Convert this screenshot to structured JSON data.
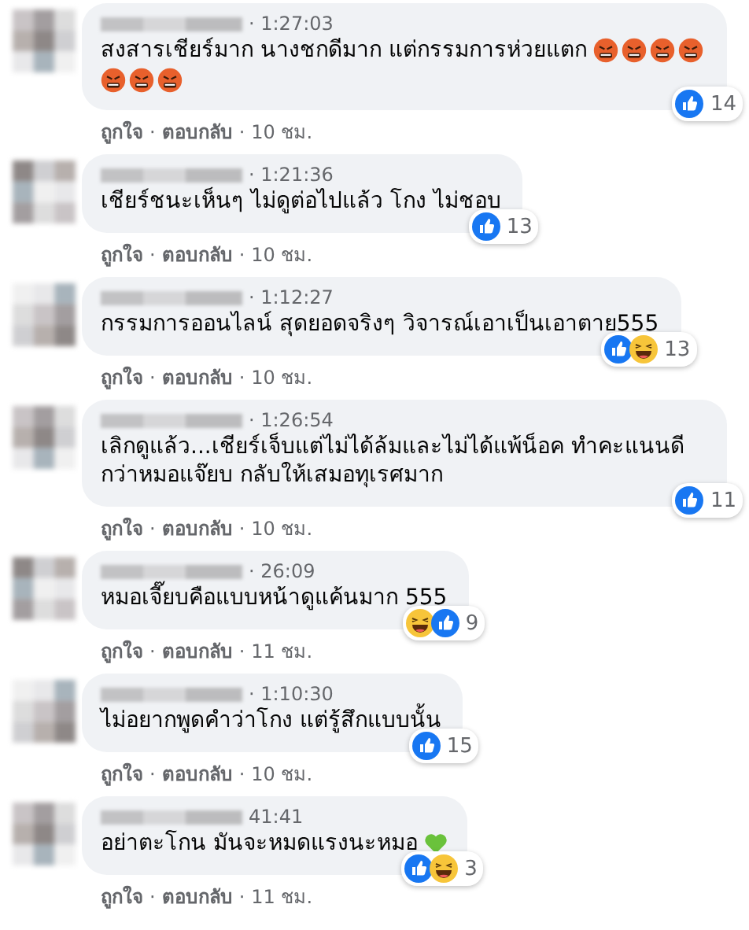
{
  "comments": [
    {
      "time": "· 1:27:03",
      "text": "สงสารเชียร์มาก นางชกดีมาก แต่กรรมการห่วยแตก",
      "emojis": [
        {
          "kind": "angry"
        },
        {
          "kind": "angry"
        },
        {
          "kind": "angry"
        },
        {
          "kind": "angry"
        },
        {
          "kind": "angry"
        },
        {
          "kind": "angry"
        },
        {
          "kind": "angry"
        }
      ],
      "reactions": [
        {
          "kind": "like"
        }
      ],
      "reaction_count": "14",
      "actions": [
        {
          "kind": "link",
          "text": "ถูกใจ"
        },
        {
          "kind": "sep",
          "text": "·"
        },
        {
          "kind": "link",
          "text": "ตอบกลับ"
        },
        {
          "kind": "sep",
          "text": "·"
        },
        {
          "kind": "age",
          "text": "10 ชม."
        }
      ]
    },
    {
      "time": "· 1:21:36",
      "text": "เชียร์ชนะเห็นๆ ไม่ดูต่อไปแล้ว โกง ไม่ชอบ",
      "reactions": [
        {
          "kind": "like"
        }
      ],
      "reaction_count": "13",
      "actions": [
        {
          "kind": "link",
          "text": "ถูกใจ"
        },
        {
          "kind": "sep",
          "text": "·"
        },
        {
          "kind": "link",
          "text": "ตอบกลับ"
        },
        {
          "kind": "sep",
          "text": "·"
        },
        {
          "kind": "age",
          "text": "10 ชม."
        }
      ]
    },
    {
      "time": "· 1:12:27",
      "text": "กรรมการออนไลน์ สุดยอดจริงๆ วิจารณ์เอาเป็นเอาตาย555",
      "reactions": [
        {
          "kind": "like"
        },
        {
          "kind": "haha"
        }
      ],
      "reaction_count": "13",
      "actions": [
        {
          "kind": "link",
          "text": "ถูกใจ"
        },
        {
          "kind": "sep",
          "text": "·"
        },
        {
          "kind": "link",
          "text": "ตอบกลับ"
        },
        {
          "kind": "sep",
          "text": "·"
        },
        {
          "kind": "age",
          "text": "10 ชม."
        }
      ]
    },
    {
      "time": "· 1:26:54",
      "text": "เลิกดูแล้ว...เชียร์เจ็บแต่ไม่ได้ล้มและไม่ได้แพ้น็อค ทำคะแนนดีกว่าหมอแจ๊ยบ กลับให้เสมอทุเรศมาก",
      "reactions": [
        {
          "kind": "like"
        }
      ],
      "reaction_count": "11",
      "actions": [
        {
          "kind": "link",
          "text": "ถูกใจ"
        },
        {
          "kind": "sep",
          "text": "·"
        },
        {
          "kind": "link",
          "text": "ตอบกลับ"
        },
        {
          "kind": "sep",
          "text": "·"
        },
        {
          "kind": "age",
          "text": "10 ชม."
        }
      ]
    },
    {
      "time": "· 26:09",
      "text": "หมอเจี๊ยบคือแบบหน้าดูแค้นมาก 555",
      "reactions": [
        {
          "kind": "haha"
        },
        {
          "kind": "like"
        }
      ],
      "reaction_count": "9",
      "actions": [
        {
          "kind": "link",
          "text": "ถูกใจ"
        },
        {
          "kind": "sep",
          "text": "·"
        },
        {
          "kind": "link",
          "text": "ตอบกลับ"
        },
        {
          "kind": "sep",
          "text": "·"
        },
        {
          "kind": "age",
          "text": "11 ชม."
        }
      ]
    },
    {
      "time": "· 1:10:30",
      "text": "ไม่อยากพูดคำว่าโกง แต่รู้สึกแบบนั้น",
      "reactions": [
        {
          "kind": "like"
        }
      ],
      "reaction_count": "15",
      "actions": [
        {
          "kind": "link",
          "text": "ถูกใจ"
        },
        {
          "kind": "sep",
          "text": "·"
        },
        {
          "kind": "link",
          "text": "ตอบกลับ"
        },
        {
          "kind": "sep",
          "text": "·"
        },
        {
          "kind": "age",
          "text": "10 ชม."
        }
      ]
    },
    {
      "time": "41:41",
      "text": "อย่าตะโกน มันจะหมดแรงนะหมอ",
      "emojis": [
        {
          "kind": "green_heart"
        }
      ],
      "reactions": [
        {
          "kind": "like"
        },
        {
          "kind": "haha"
        }
      ],
      "reaction_count": "3",
      "actions": [
        {
          "kind": "link",
          "text": "ถูกใจ"
        },
        {
          "kind": "sep",
          "text": "·"
        },
        {
          "kind": "link",
          "text": "ตอบกลับ"
        },
        {
          "kind": "sep",
          "text": "·"
        },
        {
          "kind": "age",
          "text": "11 ชม."
        }
      ]
    }
  ]
}
